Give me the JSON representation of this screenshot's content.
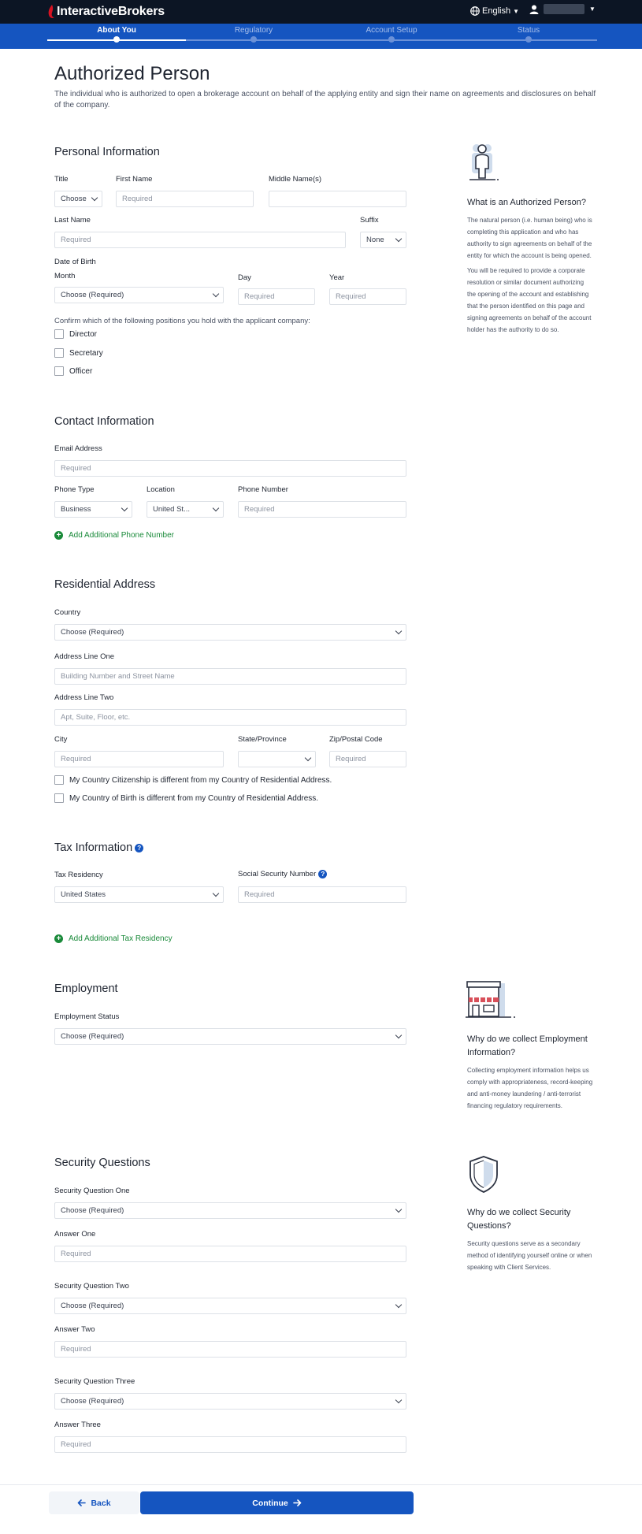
{
  "header": {
    "brand_prefix": "Interactive",
    "brand_suffix": "Brokers",
    "language": "English",
    "brand_color": "#d81222"
  },
  "steps": [
    {
      "label": "About You",
      "active": true
    },
    {
      "label": "Regulatory",
      "active": false
    },
    {
      "label": "Account Setup",
      "active": false
    },
    {
      "label": "Status",
      "active": false
    }
  ],
  "page": {
    "title": "Authorized Person",
    "description": "The individual who is authorized to open a brokerage account on behalf of the applying entity and sign their name on agreements and disclosures on behalf of the company."
  },
  "personal": {
    "title": "Personal Information",
    "title_label": "Title",
    "title_value": "Choose",
    "first_name_label": "First Name",
    "first_name_placeholder": "Required",
    "middle_name_label": "Middle Name(s)",
    "last_name_label": "Last Name",
    "last_name_placeholder": "Required",
    "suffix_label": "Suffix",
    "suffix_value": "None",
    "dob_label": "Date of Birth",
    "month_label": "Month",
    "month_value": "Choose (Required)",
    "day_label": "Day",
    "day_placeholder": "Required",
    "year_label": "Year",
    "year_placeholder": "Required",
    "positions_prompt": "Confirm which of the following positions you hold with the applicant company:",
    "positions": [
      "Director",
      "Secretary",
      "Officer"
    ]
  },
  "contact": {
    "title": "Contact Information",
    "email_label": "Email Address",
    "email_placeholder": "Required",
    "phone_type_label": "Phone Type",
    "phone_type_value": "Business",
    "location_label": "Location",
    "location_value": "United St...",
    "phone_number_label": "Phone Number",
    "phone_number_placeholder": "Required",
    "add_phone": "Add Additional Phone Number"
  },
  "address": {
    "title": "Residential Address",
    "country_label": "Country",
    "country_value": "Choose (Required)",
    "line1_label": "Address Line One",
    "line1_placeholder": "Building Number and Street Name",
    "line2_label": "Address Line Two",
    "line2_placeholder": "Apt, Suite, Floor, etc.",
    "city_label": "City",
    "city_placeholder": "Required",
    "state_label": "State/Province",
    "zip_label": "Zip/Postal Code",
    "zip_placeholder": "Required",
    "citizenship_check": "My Country Citizenship is different from my Country of Residential Address.",
    "birth_check": "My Country of Birth is different from my Country of Residential Address."
  },
  "tax": {
    "title": "Tax Information",
    "residency_label": "Tax Residency",
    "residency_value": "United States",
    "ssn_label": "Social Security Number",
    "ssn_placeholder": "Required",
    "add_residency": "Add Additional Tax Residency"
  },
  "employment": {
    "title": "Employment",
    "status_label": "Employment Status",
    "status_value": "Choose (Required)"
  },
  "security": {
    "title": "Security Questions",
    "q1_label": "Security Question One",
    "q1_value": "Choose (Required)",
    "a1_label": "Answer One",
    "a1_placeholder": "Required",
    "q2_label": "Security Question Two",
    "q2_value": "Choose (Required)",
    "a2_label": "Answer Two",
    "a2_placeholder": "Required",
    "q3_label": "Security Question Three",
    "q3_value": "Choose (Required)",
    "a3_label": "Answer Three",
    "a3_placeholder": "Required"
  },
  "aside_person": {
    "title": "What is an Authorized Person?",
    "p1": "The natural person (i.e. human being) who is completing this application and who has authority to sign agreements on behalf of the entity for which the account is being opened.",
    "p2": "You will be required to provide a corporate resolution or similar document authorizing the opening of the account and establishing that the person identified on this page and signing agreements on behalf of the account holder has the authority to do so."
  },
  "aside_employment": {
    "title": "Why do we collect Employment Information?",
    "p1": "Collecting employment information helps us comply with appropriateness, record-keeping and anti-money laundering / anti-terrorist financing regulatory requirements."
  },
  "aside_security": {
    "title": "Why do we collect Security Questions?",
    "p1": "Security questions serve as a secondary method of identifying yourself online or when speaking with Client Services."
  },
  "footer": {
    "back": "Back",
    "continue": "Continue"
  }
}
